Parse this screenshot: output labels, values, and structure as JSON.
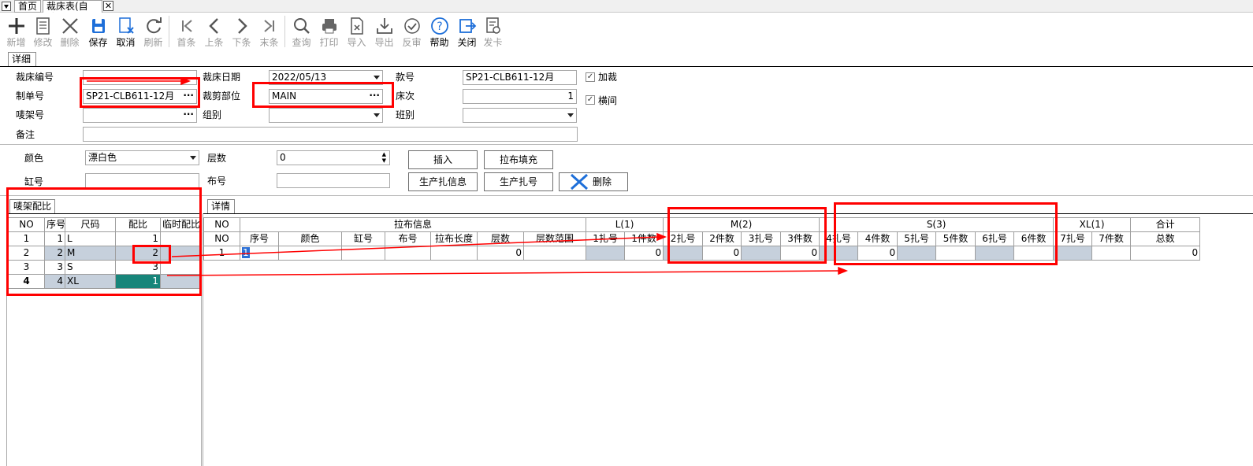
{
  "tabs": {
    "home": "首页",
    "form": "裁床表(自动)",
    "close": "✕"
  },
  "toolbar": [
    {
      "label": "新增",
      "icon": "plus-icon"
    },
    {
      "label": "修改",
      "icon": "edit-document-icon"
    },
    {
      "label": "删除",
      "icon": "x-delete-icon"
    },
    {
      "label": "保存",
      "icon": "save-icon"
    },
    {
      "label": "取消",
      "icon": "cancel-edit-icon"
    },
    {
      "label": "刷新",
      "icon": "refresh-icon"
    },
    {
      "label": "首条",
      "icon": "first-record-icon"
    },
    {
      "label": "上条",
      "icon": "previous-record-icon"
    },
    {
      "label": "下条",
      "icon": "next-record-icon"
    },
    {
      "label": "末条",
      "icon": "last-record-icon"
    },
    {
      "label": "查询",
      "icon": "search-icon"
    },
    {
      "label": "打印",
      "icon": "printer-icon"
    },
    {
      "label": "导入",
      "icon": "import-excel-icon"
    },
    {
      "label": "导出",
      "icon": "export-icon"
    },
    {
      "label": "反审",
      "icon": "unapprove-check-icon"
    },
    {
      "label": "帮助",
      "icon": "help-icon"
    },
    {
      "label": "关闭",
      "icon": "exit-icon"
    },
    {
      "label": "发卡",
      "icon": "card-issue-icon"
    }
  ],
  "detail_tab": "详细",
  "form": {
    "cut_no_label": "裁床编号",
    "cut_no": "",
    "order_no_label": "制单号",
    "order_no": "SP21-CLB611-12月",
    "rack_no_label": "唛架号",
    "rack_no": "",
    "remark_label": "备注",
    "remark": "",
    "cut_date_label": "裁床日期",
    "cut_date": "2022/05/13",
    "cut_part_label": "裁剪部位",
    "cut_part": "MAIN",
    "group_label": "组别",
    "group": "",
    "style_label": "款号",
    "style": "SP21-CLB611-12月",
    "bed_label": "床次",
    "bed": "1",
    "shift_label": "班别",
    "shift": "",
    "add_cut_label": "加裁",
    "add_cut_checked": "☑",
    "horizontal_label": "横间",
    "horizontal_checked": "☑",
    "check_mark": "✓"
  },
  "color_row": {
    "color_label": "颜色",
    "color": "漂白色",
    "layers_label": "层数",
    "layers": "0",
    "vat_label": "缸号",
    "vat": "",
    "cloth_label": "布号",
    "cloth": "",
    "insert_btn": "插入",
    "fill_btn": "拉布填充",
    "bundle_info_btn": "生产扎信息",
    "bundle_no_btn": "生产扎号",
    "delete_btn": "删除"
  },
  "left_panel": {
    "tab": "唛架配比",
    "headers": [
      "NO",
      "序号",
      "尺码",
      "配比",
      "临时配比"
    ],
    "rows": [
      {
        "no": "1",
        "seq": "1",
        "size": "L",
        "ratio": "1",
        "temp": ""
      },
      {
        "no": "2",
        "seq": "2",
        "size": "M",
        "ratio": "2",
        "temp": ""
      },
      {
        "no": "3",
        "seq": "3",
        "size": "S",
        "ratio": "3",
        "temp": ""
      },
      {
        "no": "4",
        "seq": "4",
        "size": "XL",
        "ratio": "1",
        "temp": ""
      }
    ]
  },
  "right_panel": {
    "tab": "详情",
    "group_headers": {
      "no": "NO",
      "cloth_info": "拉布信息",
      "l": "L(1)",
      "m": "M(2)",
      "s": "S(3)",
      "xl": "XL(1)",
      "total": "合计"
    },
    "sub_headers": [
      "NO",
      "序号",
      "颜色",
      "缸号",
      "布号",
      "拉布长度",
      "层数",
      "层数范围",
      "1扎号",
      "1件数",
      "2扎号",
      "2件数",
      "3扎号",
      "3件数",
      "4扎号",
      "4件数",
      "5扎号",
      "5件数",
      "6扎号",
      "6件数",
      "7扎号",
      "7件数",
      "总数"
    ],
    "row": {
      "no": "1",
      "seq": "1",
      "c1": "0",
      "c2": "0",
      "c3": "0",
      "c4": "0",
      "c5": "0",
      "total": "0"
    }
  },
  "colors": {
    "accent_red": "#ff0000",
    "selected_teal": "#17857a",
    "gray_cell": "#c6d0dc",
    "save_blue": "#1e6fd9"
  }
}
